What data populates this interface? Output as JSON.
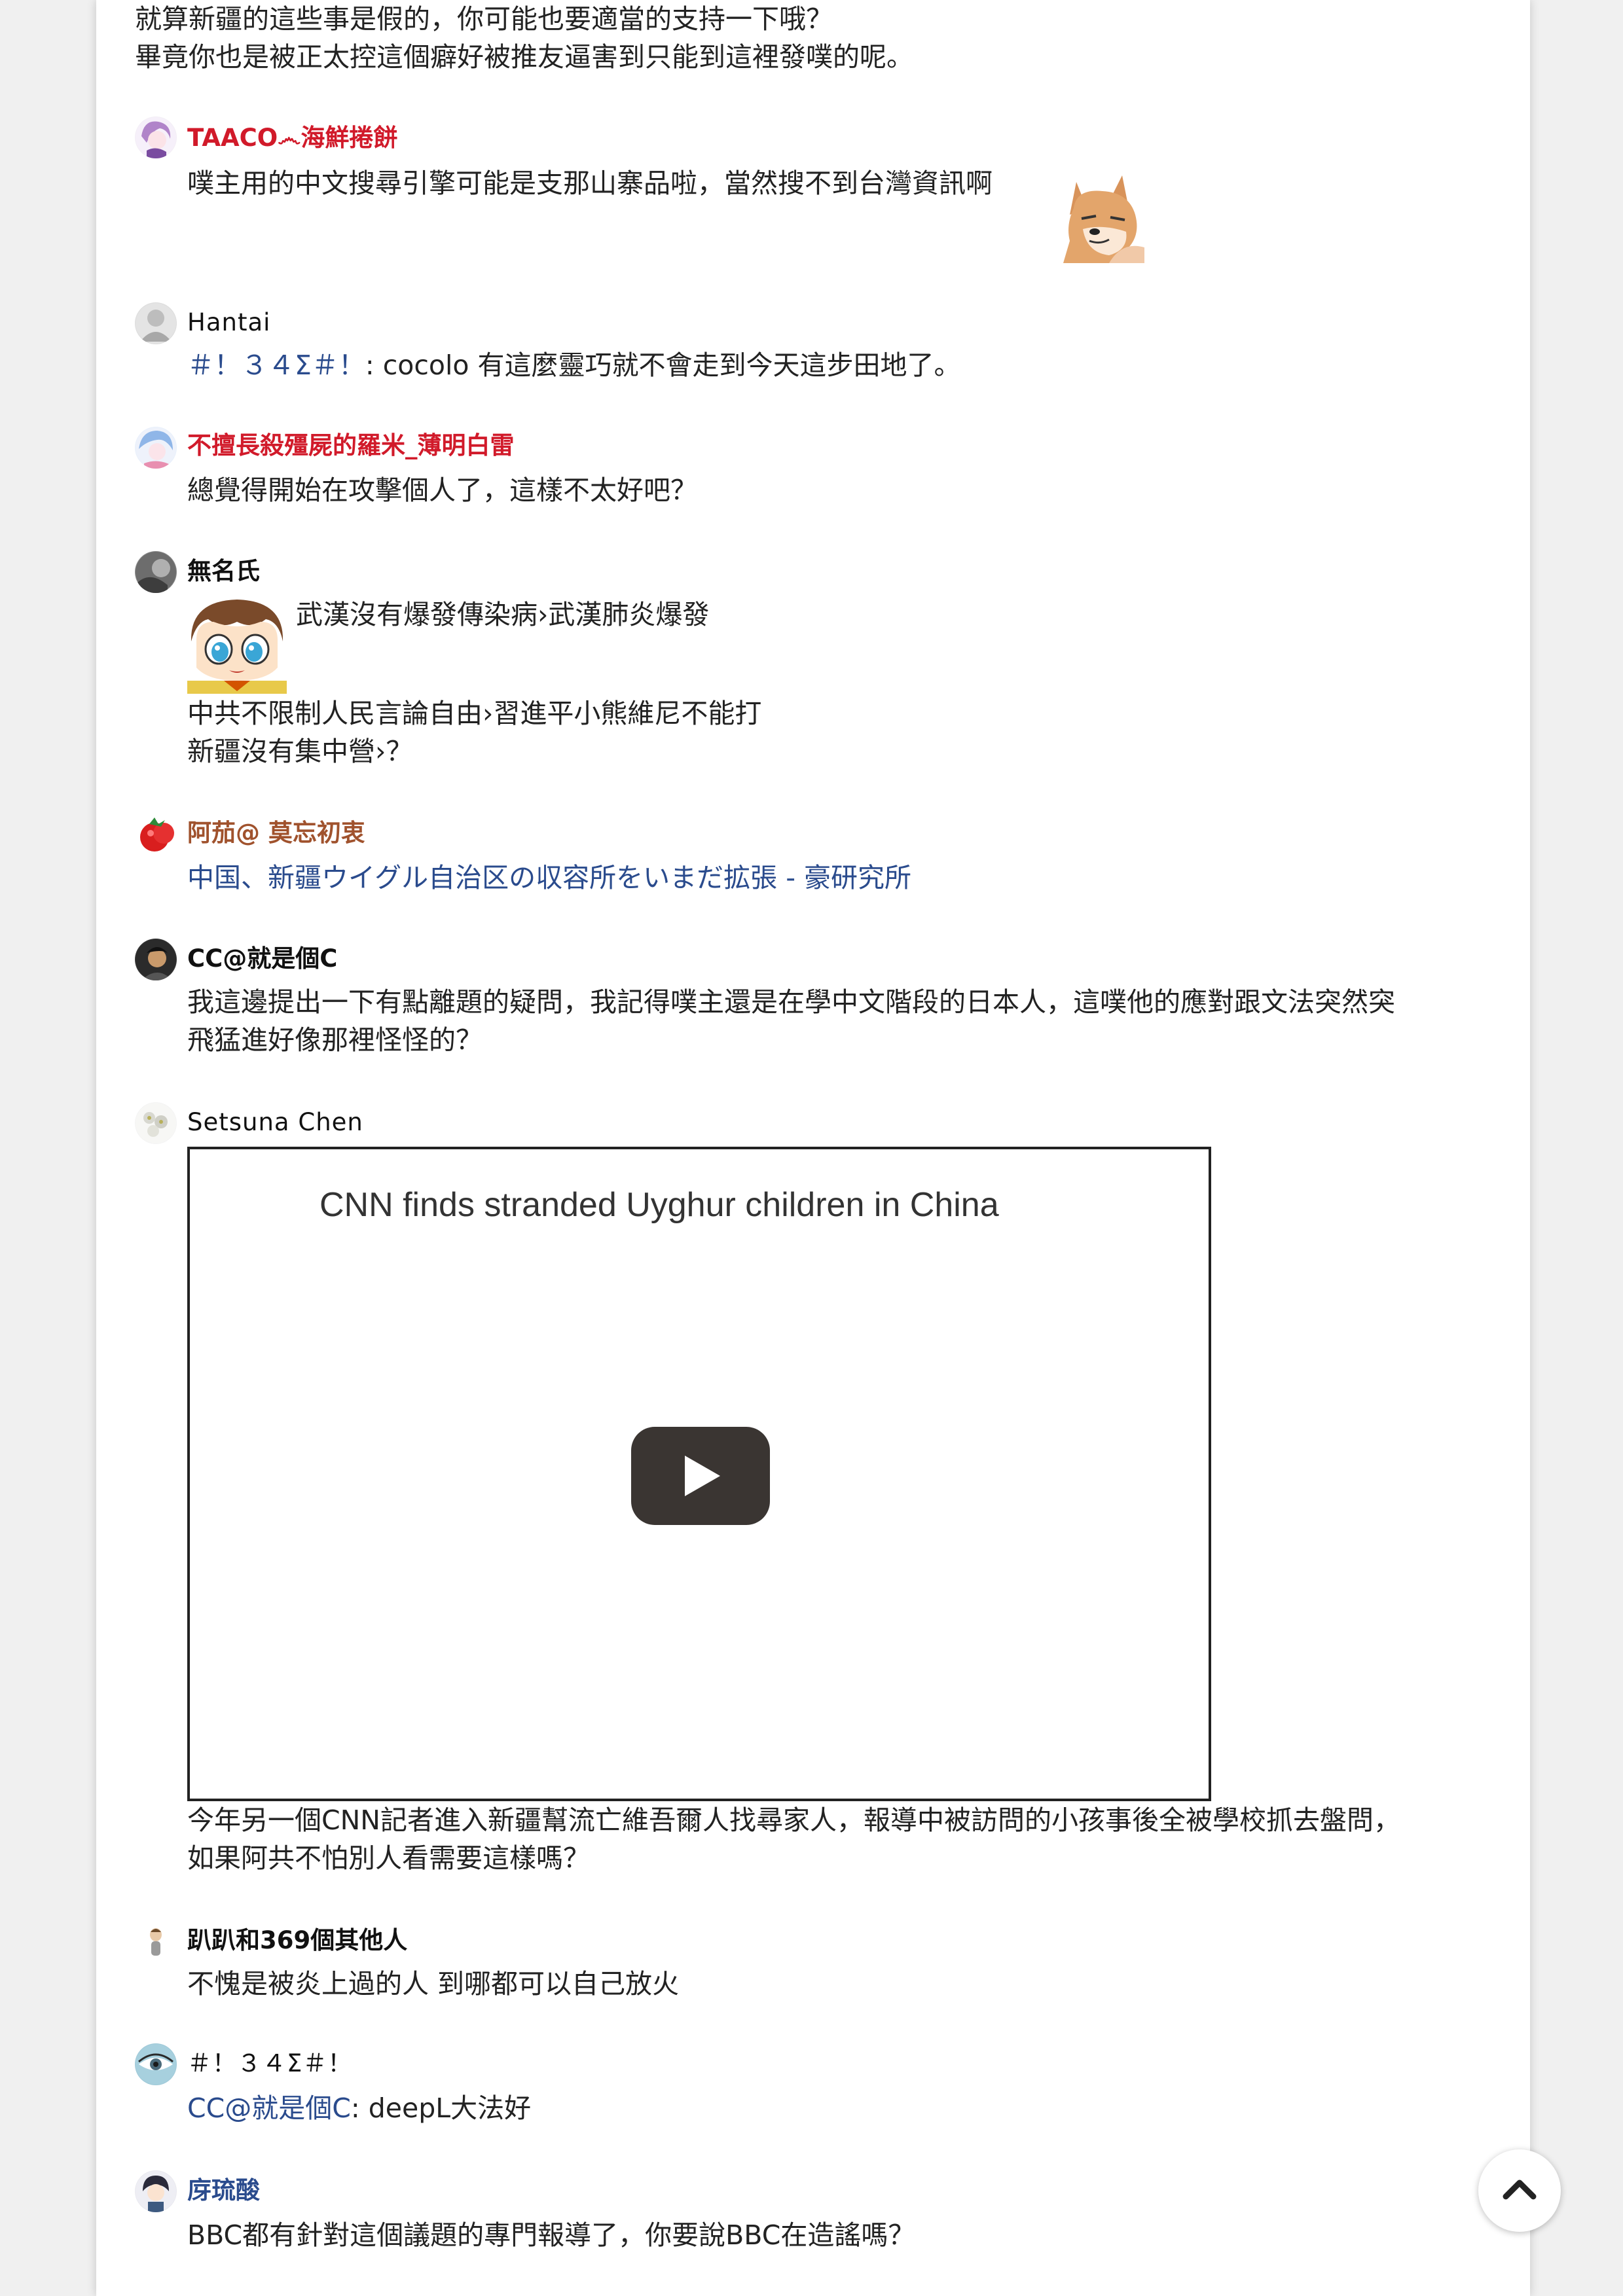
{
  "top_lines": [
    "就算新疆的這些事是假的，你可能也要適當的支持一下哦？",
    "畢竟你也是被正太控這個癖好被推友逼害到只能到這裡發噗的呢。"
  ],
  "comments": [
    {
      "name": "TAACO෴海鮮捲餅",
      "text": "噗主用的中文搜尋引擎可能是支那山寨品啦，當然搜不到台灣資訊啊"
    },
    {
      "name": "Hantai",
      "mention": "＃！３４Σ＃！",
      "text": ": cocolo 有這麼靈巧就不會走到今天這步田地了。"
    },
    {
      "name": "不擅長殺殭屍的羅米_薄明白雷",
      "text": "總覺得開始在攻擊個人了，這樣不太好吧？"
    },
    {
      "name": "無名氏",
      "lines": [
        "武漢沒有爆發傳染病›武漢肺炎爆發",
        "中共不限制人民言論自由›習進平小熊維尼不能打",
        "新疆沒有集中營›？"
      ]
    },
    {
      "name": "阿茄@ 莫忘初衷",
      "link": "中国、新疆ウイグル自治区の収容所をいまだ拡張 - 豪研究所"
    },
    {
      "name": "CC@就是個C",
      "lines": [
        "我這邊提出一下有點離題的疑問，我記得噗主還是在學中文階段的日本人，這噗他的應對跟文法突然突",
        "飛猛進好像那裡怪怪的？"
      ]
    },
    {
      "name": "Setsuna Chen",
      "video_title": "CNN finds stranded Uyghur children in China",
      "lines": [
        "今年另一個CNN記者進入新疆幫流亡維吾爾人找尋家人，報導中被訪問的小孩事後全被學校抓去盤問，",
        "如果阿共不怕別人看需要這樣嗎？"
      ]
    },
    {
      "name": "趴趴和369個其他人",
      "text": "不愧是被炎上過的人 到哪都可以自己放火"
    },
    {
      "name": "＃！３４Σ＃！",
      "mention": "CC@就是個C",
      "text": ": deepL大法好"
    },
    {
      "name": "庌琉酸",
      "text": "BBC都有針對這個議題的專門報導了，你要說BBC在造謠嗎？"
    }
  ],
  "icons": {
    "play": "play-icon",
    "scroll_top": "chevron-up-icon"
  },
  "colors": {
    "link": "#2a4b8d",
    "name_red": "#d11a2a",
    "name_brown": "#a0522d"
  }
}
